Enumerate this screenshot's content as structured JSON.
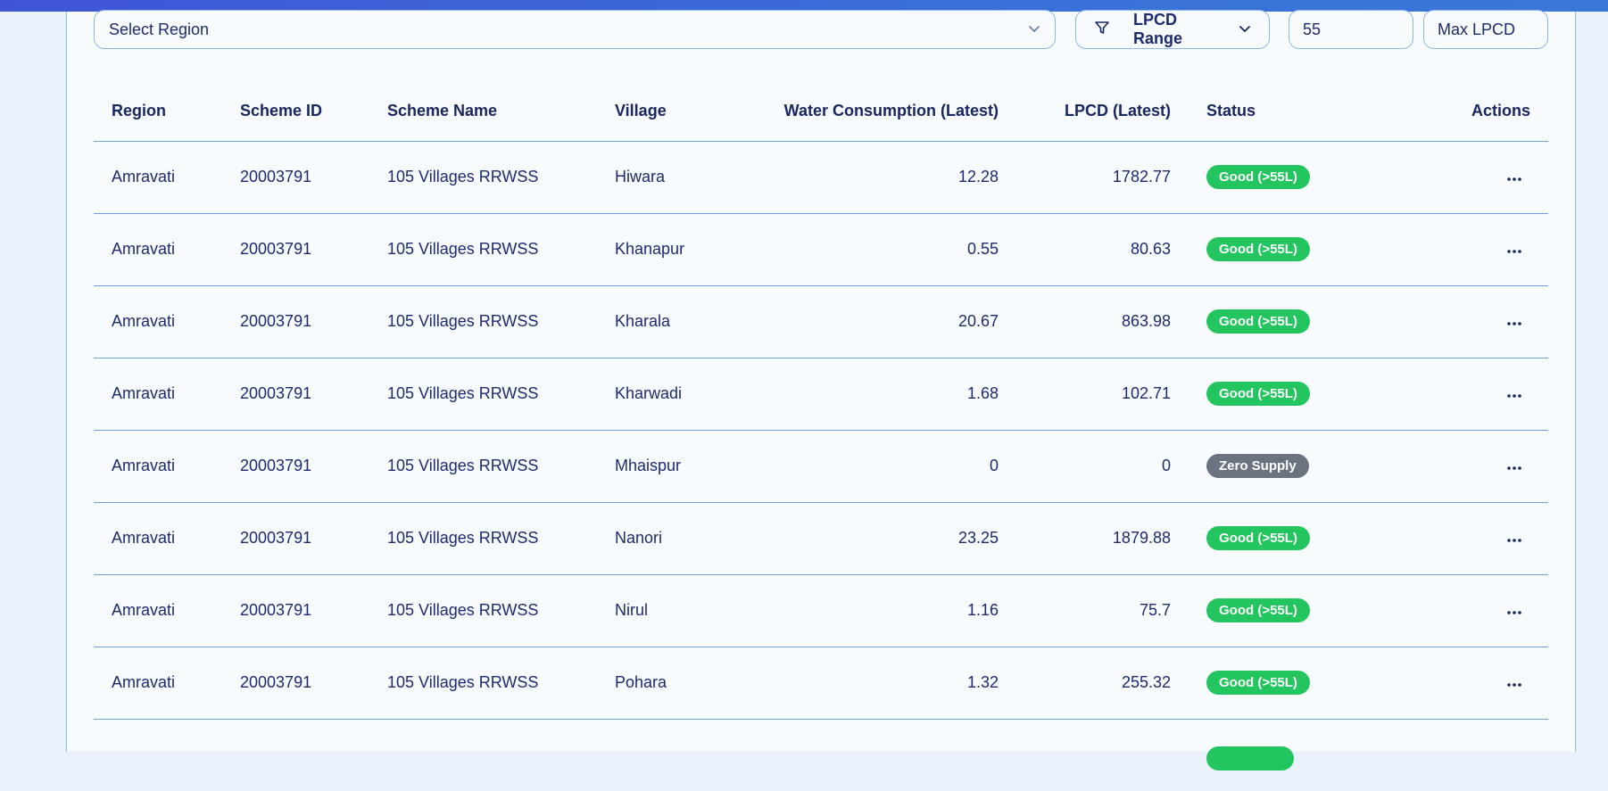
{
  "filters": {
    "region_select": {
      "value": "Select Region"
    },
    "lpcd_range_label": "LPCD Range",
    "min_lpcd": {
      "value": "55"
    },
    "max_lpcd": {
      "placeholder": "Max LPCD"
    }
  },
  "table": {
    "headers": {
      "region": "Region",
      "scheme_id": "Scheme ID",
      "scheme_name": "Scheme Name",
      "village": "Village",
      "water_consumption": "Water Consumption (Latest)",
      "lpcd": "LPCD (Latest)",
      "status": "Status",
      "actions": "Actions"
    },
    "rows": [
      {
        "region": "Amravati",
        "scheme_id": "20003791",
        "scheme_name": "105 Villages RRWSS",
        "village": "Hiwara",
        "water_consumption": "12.28",
        "lpcd": "1782.77",
        "status": "Good (>55L)",
        "status_kind": "good"
      },
      {
        "region": "Amravati",
        "scheme_id": "20003791",
        "scheme_name": "105 Villages RRWSS",
        "village": "Khanapur",
        "water_consumption": "0.55",
        "lpcd": "80.63",
        "status": "Good (>55L)",
        "status_kind": "good"
      },
      {
        "region": "Amravati",
        "scheme_id": "20003791",
        "scheme_name": "105 Villages RRWSS",
        "village": "Kharala",
        "water_consumption": "20.67",
        "lpcd": "863.98",
        "status": "Good (>55L)",
        "status_kind": "good"
      },
      {
        "region": "Amravati",
        "scheme_id": "20003791",
        "scheme_name": "105 Villages RRWSS",
        "village": "Kharwadi",
        "water_consumption": "1.68",
        "lpcd": "102.71",
        "status": "Good (>55L)",
        "status_kind": "good"
      },
      {
        "region": "Amravati",
        "scheme_id": "20003791",
        "scheme_name": "105 Villages RRWSS",
        "village": "Mhaispur",
        "water_consumption": "0",
        "lpcd": "0",
        "status": "Zero Supply",
        "status_kind": "zero"
      },
      {
        "region": "Amravati",
        "scheme_id": "20003791",
        "scheme_name": "105 Villages RRWSS",
        "village": "Nanori",
        "water_consumption": "23.25",
        "lpcd": "1879.88",
        "status": "Good (>55L)",
        "status_kind": "good"
      },
      {
        "region": "Amravati",
        "scheme_id": "20003791",
        "scheme_name": "105 Villages RRWSS",
        "village": "Nirul",
        "water_consumption": "1.16",
        "lpcd": "75.7",
        "status": "Good (>55L)",
        "status_kind": "good"
      },
      {
        "region": "Amravati",
        "scheme_id": "20003791",
        "scheme_name": "105 Villages RRWSS",
        "village": "Pohara",
        "water_consumption": "1.32",
        "lpcd": "255.32",
        "status": "Good (>55L)",
        "status_kind": "good"
      }
    ]
  },
  "colors": {
    "good": "#22c55e",
    "zero_supply": "#6b7280",
    "accent": "#3f55d6",
    "border": "#8fb6e6"
  },
  "icons": {
    "region_dropdown": "chevron-down-icon",
    "lpcd_filter": "filter-icon",
    "lpcd_dropdown": "chevron-down-icon",
    "row_actions": "more-horizontal-icon"
  }
}
